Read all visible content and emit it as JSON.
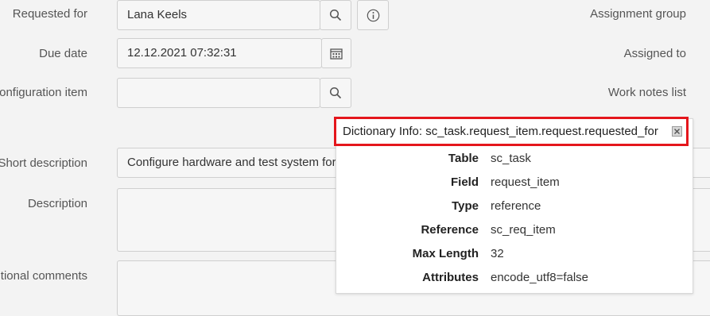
{
  "form": {
    "requested_for": {
      "label": "Requested for",
      "value": "Lana Keels"
    },
    "due_date": {
      "label": "Due date",
      "value": "12.12.2021 07:32:31"
    },
    "configuration_item": {
      "label": "Configuration item",
      "value": ""
    },
    "short_description": {
      "label": "Short description",
      "value": "Configure hardware and test system for"
    },
    "description": {
      "label": "Description",
      "value": ""
    },
    "additional_comments": {
      "label": "Additional comments",
      "value": ""
    }
  },
  "right_labels": {
    "assignment_group": "Assignment group",
    "assigned_to": "Assigned to",
    "work_notes_list": "Work notes list"
  },
  "popup": {
    "title": "Dictionary Info: sc_task.request_item.request.requested_for",
    "rows": [
      {
        "key": "Table",
        "value": "sc_task"
      },
      {
        "key": "Field",
        "value": "request_item"
      },
      {
        "key": "Type",
        "value": "reference"
      },
      {
        "key": "Reference",
        "value": "sc_req_item"
      },
      {
        "key": "Max Length",
        "value": "32"
      },
      {
        "key": "Attributes",
        "value": "encode_utf8=false"
      }
    ]
  },
  "icons": {
    "search": "search-icon",
    "info": "info-icon",
    "calendar": "calendar-icon",
    "close": "close-icon"
  },
  "colors": {
    "highlight": "#e4161c",
    "background": "#f3f3f3"
  }
}
